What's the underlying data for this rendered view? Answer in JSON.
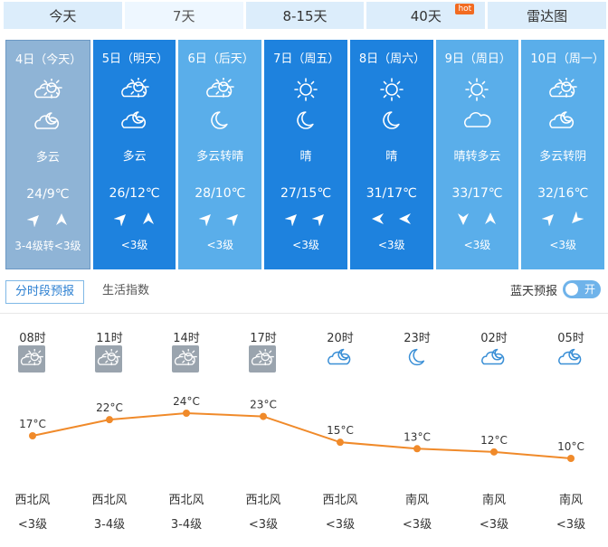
{
  "tabs": [
    {
      "label": "今天"
    },
    {
      "label": "7天",
      "active": true
    },
    {
      "label": "8-15天"
    },
    {
      "label": "40天",
      "badge": "hot"
    },
    {
      "label": "雷达图"
    }
  ],
  "days": [
    {
      "date": "4日（今天）",
      "icon_day": "partly-cloudy-icon",
      "icon_night": "cloudy-night-icon",
      "desc": "多云",
      "temp": "24/9℃",
      "wind_icons": [
        "wind-arrow-ne-icon",
        "wind-arrow-n-icon"
      ],
      "wind": "3-4级转<3级",
      "color": "#8fb4d6",
      "selected": true
    },
    {
      "date": "5日（明天）",
      "icon_day": "partly-cloudy-icon",
      "icon_night": "cloudy-night-icon",
      "desc": "多云",
      "temp": "26/12℃",
      "wind_icons": [
        "wind-arrow-ne-icon",
        "wind-arrow-n-icon"
      ],
      "wind": "<3级",
      "color": "#1e82de"
    },
    {
      "date": "6日（后天）",
      "icon_day": "partly-cloudy-icon",
      "icon_night": "moon-icon",
      "desc": "多云转晴",
      "temp": "28/10℃",
      "wind_icons": [
        "wind-arrow-ne-icon",
        "wind-arrow-ne-icon"
      ],
      "wind": "<3级",
      "color": "#5aaeea"
    },
    {
      "date": "7日（周五）",
      "icon_day": "sun-icon",
      "icon_night": "moon-icon",
      "desc": "晴",
      "temp": "27/15℃",
      "wind_icons": [
        "wind-arrow-ne-icon",
        "wind-arrow-ne-icon"
      ],
      "wind": "<3级",
      "color": "#1e82de"
    },
    {
      "date": "8日（周六）",
      "icon_day": "sun-icon",
      "icon_night": "moon-icon",
      "desc": "晴",
      "temp": "31/17℃",
      "wind_icons": [
        "wind-arrow-w-icon",
        "wind-arrow-w-icon"
      ],
      "wind": "<3级",
      "color": "#1e82de"
    },
    {
      "date": "9日（周日）",
      "icon_day": "sun-icon",
      "icon_night": "cloud-icon",
      "desc": "晴转多云",
      "temp": "33/17℃",
      "wind_icons": [
        "wind-arrow-s-icon",
        "wind-arrow-n-icon"
      ],
      "wind": "<3级",
      "color": "#5aaeea"
    },
    {
      "date": "10日（周一）",
      "icon_day": "partly-cloudy-icon",
      "icon_night": "cloudy-night-icon",
      "desc": "多云转阴",
      "temp": "32/16℃",
      "wind_icons": [
        "wind-arrow-ne-icon",
        "wind-arrow-sw-icon"
      ],
      "wind": "<3级",
      "color": "#5aaeea"
    }
  ],
  "subtabs": [
    {
      "label": "分时段预报",
      "active": true
    },
    {
      "label": "生活指数"
    }
  ],
  "bluesky": {
    "label": "蓝天预报",
    "toggle": "开"
  },
  "hourly": [
    {
      "time": "08时",
      "icon": "cloudy-day-icon",
      "temp": "17°C",
      "temp_value": 17,
      "wdir": "西北风",
      "wlev": "<3级",
      "icon_boxed": true
    },
    {
      "time": "11时",
      "icon": "cloudy-day-icon",
      "temp": "22°C",
      "temp_value": 22,
      "wdir": "西北风",
      "wlev": "3-4级",
      "icon_boxed": true
    },
    {
      "time": "14时",
      "icon": "cloudy-day-icon",
      "temp": "24°C",
      "temp_value": 24,
      "wdir": "西北风",
      "wlev": "3-4级",
      "icon_boxed": true
    },
    {
      "time": "17时",
      "icon": "cloudy-day-icon",
      "temp": "23°C",
      "temp_value": 23,
      "wdir": "西北风",
      "wlev": "<3级",
      "icon_boxed": true
    },
    {
      "time": "20时",
      "icon": "cloudy-night-icon",
      "temp": "15°C",
      "temp_value": 15,
      "wdir": "西北风",
      "wlev": "<3级"
    },
    {
      "time": "23时",
      "icon": "moon-icon",
      "temp": "13°C",
      "temp_value": 13,
      "wdir": "南风",
      "wlev": "<3级"
    },
    {
      "time": "02时",
      "icon": "cloudy-night-icon",
      "temp": "12°C",
      "temp_value": 12,
      "wdir": "南风",
      "wlev": "<3级"
    },
    {
      "time": "05时",
      "icon": "cloudy-night-icon",
      "temp": "10°C",
      "temp_value": 10,
      "wdir": "南风",
      "wlev": "<3级"
    }
  ],
  "colors": {
    "line": "#f08a2a",
    "selected_card": "#8fb4d6",
    "card_dark": "#1e82de",
    "card_light": "#5aaeea"
  }
}
